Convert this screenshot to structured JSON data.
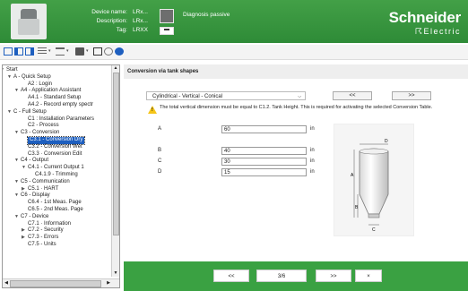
{
  "header": {
    "labels": {
      "device_name": "Device name:",
      "description": "Description:",
      "tag": "Tag:"
    },
    "values": {
      "device_name": "LRx...",
      "description": "LRx...",
      "tag": "LRXX"
    },
    "diagnosis_text": "Diagnosis passive",
    "logo_name": "Schneider",
    "logo_sub": "Electric"
  },
  "colors": {
    "brand_green": "#3aa142",
    "selection_blue": "#1e5fbf"
  },
  "sidebar": {
    "items": [
      {
        "label": "Start",
        "indent": 0,
        "arrow": "▼",
        "selected": false
      },
      {
        "label": "A - Quick Setup",
        "indent": 1,
        "arrow": "▼",
        "selected": false
      },
      {
        "label": "A2 : Login",
        "indent": 3,
        "arrow": "",
        "selected": false
      },
      {
        "label": "A4 - Application Assistant",
        "indent": 2,
        "arrow": "▼",
        "selected": false
      },
      {
        "label": "A4.1 - Standard Setup",
        "indent": 3,
        "arrow": "",
        "selected": false
      },
      {
        "label": "A4.2 - Record empty spectr",
        "indent": 3,
        "arrow": "",
        "selected": false
      },
      {
        "label": "C - Full Setup",
        "indent": 1,
        "arrow": "▼",
        "selected": false
      },
      {
        "label": "C1 : Installation Parameters",
        "indent": 3,
        "arrow": "",
        "selected": false
      },
      {
        "label": "C2 - Process",
        "indent": 3,
        "arrow": "",
        "selected": false
      },
      {
        "label": "C3 - Conversion",
        "indent": 2,
        "arrow": "▼",
        "selected": false
      },
      {
        "label": "C3.1 - Conversion Dry",
        "indent": 3,
        "arrow": "",
        "selected": true
      },
      {
        "label": "C3.2 - Conversion Wet",
        "indent": 3,
        "arrow": "",
        "selected": false
      },
      {
        "label": "C3.3 · Conversion Edit",
        "indent": 3,
        "arrow": "",
        "selected": false
      },
      {
        "label": "C4 - Output",
        "indent": 2,
        "arrow": "▼",
        "selected": false
      },
      {
        "label": "C4.1 - Current Output 1",
        "indent": 3,
        "arrow": "▼",
        "selected": false
      },
      {
        "label": "C4.1.9 - Trimming",
        "indent": 4,
        "arrow": "",
        "selected": false
      },
      {
        "label": "C5 - Communication",
        "indent": 2,
        "arrow": "▼",
        "selected": false
      },
      {
        "label": "C5.1 · HART",
        "indent": 3,
        "arrow": "▶",
        "selected": false
      },
      {
        "label": "C6 - Display",
        "indent": 2,
        "arrow": "▼",
        "selected": false
      },
      {
        "label": "C6.4 - 1st Meas. Page",
        "indent": 3,
        "arrow": "",
        "selected": false
      },
      {
        "label": "C6.5 - 2nd Meas. Page",
        "indent": 3,
        "arrow": "",
        "selected": false
      },
      {
        "label": "C7 - Device",
        "indent": 2,
        "arrow": "▼",
        "selected": false
      },
      {
        "label": "C7.1 · Information",
        "indent": 3,
        "arrow": "",
        "selected": false
      },
      {
        "label": "C7.2 - Security",
        "indent": 3,
        "arrow": "▶",
        "selected": false
      },
      {
        "label": "C7.3 - Errors",
        "indent": 3,
        "arrow": "▶",
        "selected": false
      },
      {
        "label": "C7.5 - Units",
        "indent": 3,
        "arrow": "",
        "selected": false
      }
    ]
  },
  "main": {
    "title": "Conversion via tank shapes",
    "shape_select": "Cylindrical - Vertical - Conical",
    "prev_label": "<<",
    "next_label": ">>",
    "info": "The total vertical dimension must be equal to C1.2. Tank Height. This is required for activating the selected Conversion Table.",
    "fields": [
      {
        "name": "A",
        "value": "60",
        "unit": "in"
      },
      {
        "name": "B",
        "value": "40",
        "unit": "in"
      },
      {
        "name": "C",
        "value": "30",
        "unit": "in"
      },
      {
        "name": "D",
        "value": "15",
        "unit": "in"
      }
    ],
    "diagram_labels": {
      "a": "A",
      "b": "B",
      "c": "C",
      "d": "D"
    }
  },
  "footer": {
    "first": "<<",
    "page": "3/6",
    "next": ">>",
    "close": "×"
  }
}
